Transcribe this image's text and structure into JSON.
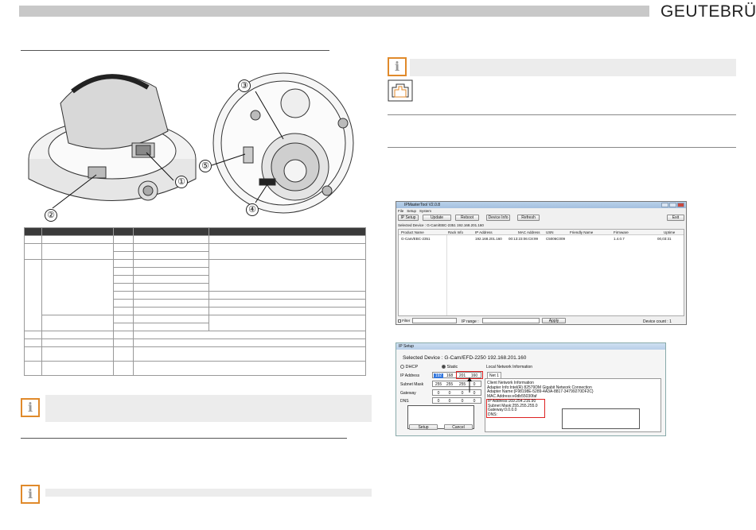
{
  "header": {
    "brand": "GEUTEBRÜCK"
  },
  "callouts": [
    "①",
    "②",
    "③",
    "④",
    "⑤"
  ],
  "ipmaster": {
    "title": "IPMasterTool V2.0.8",
    "menu": [
      "File",
      "Setup",
      "System"
    ],
    "buttons": {
      "ip_setup": "IP Setup",
      "update": "Update",
      "reboot": "Reboot",
      "device_info": "Device Info",
      "refresh": "Refresh",
      "exit": "Exit"
    },
    "selected_device_label": "Selected Device :",
    "selected_device_value": "G-Cam/EBC-2351 192.168.201.160",
    "columns": [
      "Product Name",
      "Rack Info",
      "IP Address",
      "MAC Address",
      "USN",
      "Friendly Name",
      "Firmware",
      "Uptime"
    ],
    "rows": [
      [
        "G-Cam/EBC-2351",
        "",
        "192.168.201.160",
        "00:13:23:06:C8:99",
        "C5006C009",
        "",
        "1.4.0.7",
        "00,03:31"
      ]
    ],
    "filter_label": "Filter",
    "ip_range_label": "IP range :",
    "apply": "Apply",
    "device_count": "Device count : 1"
  },
  "ipsetup": {
    "title": "IP Setup",
    "selected_device_label": "Selected Device :",
    "selected_device_value": "G-Cam/EFD-2250 192.168.201.160",
    "dhcp": "DHCP",
    "static": "Static",
    "fields": [
      {
        "label": "IP Address",
        "octets": [
          "192",
          "168",
          "201",
          "160"
        ]
      },
      {
        "label": "Subnet Mask",
        "octets": [
          "255",
          "255",
          "255",
          "0"
        ]
      },
      {
        "label": "Gateway",
        "octets": [
          "0",
          "0",
          "0",
          "0"
        ]
      },
      {
        "label": "DNS",
        "octets": [
          "0",
          "0",
          "0",
          "0"
        ]
      }
    ],
    "local_net_title": "Local Network Information",
    "net_tab": "Net 1",
    "net_lines": [
      "Client Network Information",
      "Adapter Info:Intel(R) 82579DM Gigabit Network Connection",
      "Adapter Name:{F98198E-5289-4A3A-8817-34799270DF2C}",
      "MAC Address:e0db55030faf"
    ],
    "net_highlight": [
      "IP Address:169.254.216.90",
      "Subnet Mask:255.255.255.0",
      "Gateway:0.0.0.0",
      "DNS:"
    ],
    "setup_btn": "Setup",
    "cancel_btn": "Cancel"
  },
  "colors": {
    "accent": "#e08a2b",
    "topbar": "#c8c8c8",
    "highlight": "#dd2222"
  }
}
